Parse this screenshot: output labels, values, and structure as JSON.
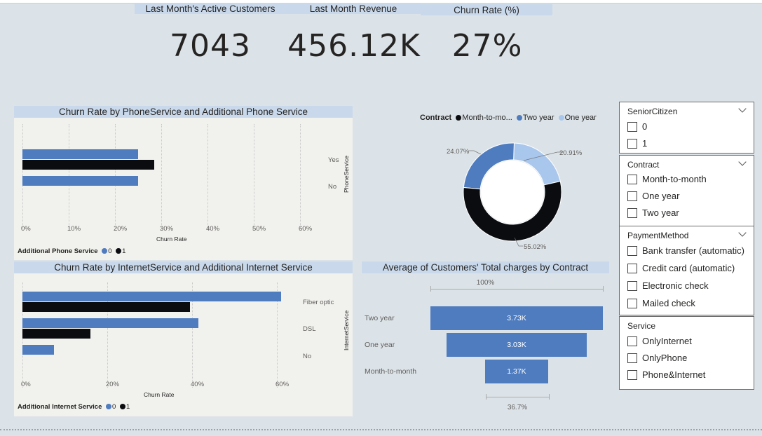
{
  "kpis": {
    "active_customers": {
      "title": "Last Month's Active Customers",
      "value": "7043"
    },
    "revenue": {
      "title": "Last Month Revenue",
      "value": "456.12K"
    },
    "churn_rate": {
      "title": "Churn Rate (%)",
      "value": "27%"
    }
  },
  "colors": {
    "blue": "#4f7cbf",
    "black": "#0b0c10",
    "light_blue": "#a9c7ec",
    "header": "#c9d9eb"
  },
  "phone_chart": {
    "title": "Churn Rate by PhoneService and Additional Phone Service",
    "axis_title": "Churn Rate",
    "y_axis_title": "PhoneService",
    "ticks": [
      "0%",
      "10%",
      "20%",
      "30%",
      "40%",
      "50%",
      "60%"
    ],
    "categories": [
      "Yes",
      "No"
    ],
    "legend_title": "Additional Phone Service",
    "legend_items": [
      "0",
      "1"
    ]
  },
  "internet_chart": {
    "title": "Churn Rate by InternetService and Additional Internet Service",
    "axis_title": "Churn Rate",
    "y_axis_title": "InternetService",
    "ticks": [
      "0%",
      "20%",
      "40%",
      "60%"
    ],
    "categories": [
      "Fiber optic",
      "DSL",
      "No"
    ],
    "legend_title": "Additional Internet Service",
    "legend_items": [
      "0",
      "1"
    ]
  },
  "donut": {
    "legend_title": "Contract",
    "legend_items": [
      "Month-to-mo...",
      "Two year",
      "One year"
    ],
    "labels": [
      "55.02%",
      "24.07%",
      "20.91%"
    ]
  },
  "funnel": {
    "title": "Average of Customers' Total charges by Contract",
    "top_label": "100%",
    "bottom_label": "36.7%",
    "categories": [
      "Two year",
      "One year",
      "Month-to-month"
    ],
    "value_labels": [
      "3.73K",
      "3.03K",
      "1.37K"
    ]
  },
  "chart_data": [
    {
      "type": "bar",
      "title": "Churn Rate by PhoneService and Additional Phone Service",
      "xlabel": "Churn Rate",
      "ylabel": "PhoneService",
      "categories": [
        "Yes",
        "No"
      ],
      "xlim": [
        0,
        0.6
      ],
      "series": [
        {
          "name": "0",
          "values": [
            0.25,
            0.25
          ]
        },
        {
          "name": "1",
          "values": [
            0.285,
            null
          ]
        }
      ]
    },
    {
      "type": "bar",
      "title": "Churn Rate by InternetService and Additional Internet Service",
      "xlabel": "Churn Rate",
      "ylabel": "InternetService",
      "categories": [
        "Fiber optic",
        "DSL",
        "No"
      ],
      "xlim": [
        0,
        0.6
      ],
      "series": [
        {
          "name": "0",
          "values": [
            0.61,
            0.415,
            0.075
          ]
        },
        {
          "name": "1",
          "values": [
            0.395,
            0.16,
            null
          ]
        }
      ]
    },
    {
      "type": "pie",
      "legend_title": "Contract",
      "categories": [
        "Month-to-mo...",
        "Two year",
        "One year"
      ],
      "values": [
        55.02,
        24.07,
        20.91
      ]
    },
    {
      "type": "bar",
      "title": "Average of Customers' Total charges by Contract",
      "categories": [
        "Two year",
        "One year",
        "Month-to-month"
      ],
      "values": [
        3730,
        3030,
        1370
      ]
    }
  ],
  "slicers": [
    {
      "title": "SeniorCitizen",
      "has_chevron": true,
      "options": [
        "0",
        "1"
      ]
    },
    {
      "title": "Contract",
      "has_chevron": true,
      "options": [
        "Month-to-month",
        "One year",
        "Two year"
      ]
    },
    {
      "title": "PaymentMethod",
      "has_chevron": true,
      "options": [
        "Bank transfer (automatic)",
        "Credit card (automatic)",
        "Electronic check",
        "Mailed check"
      ]
    },
    {
      "title": "Service",
      "has_chevron": false,
      "options": [
        "OnlyInternet",
        "OnlyPhone",
        "Phone&Internet"
      ]
    }
  ]
}
